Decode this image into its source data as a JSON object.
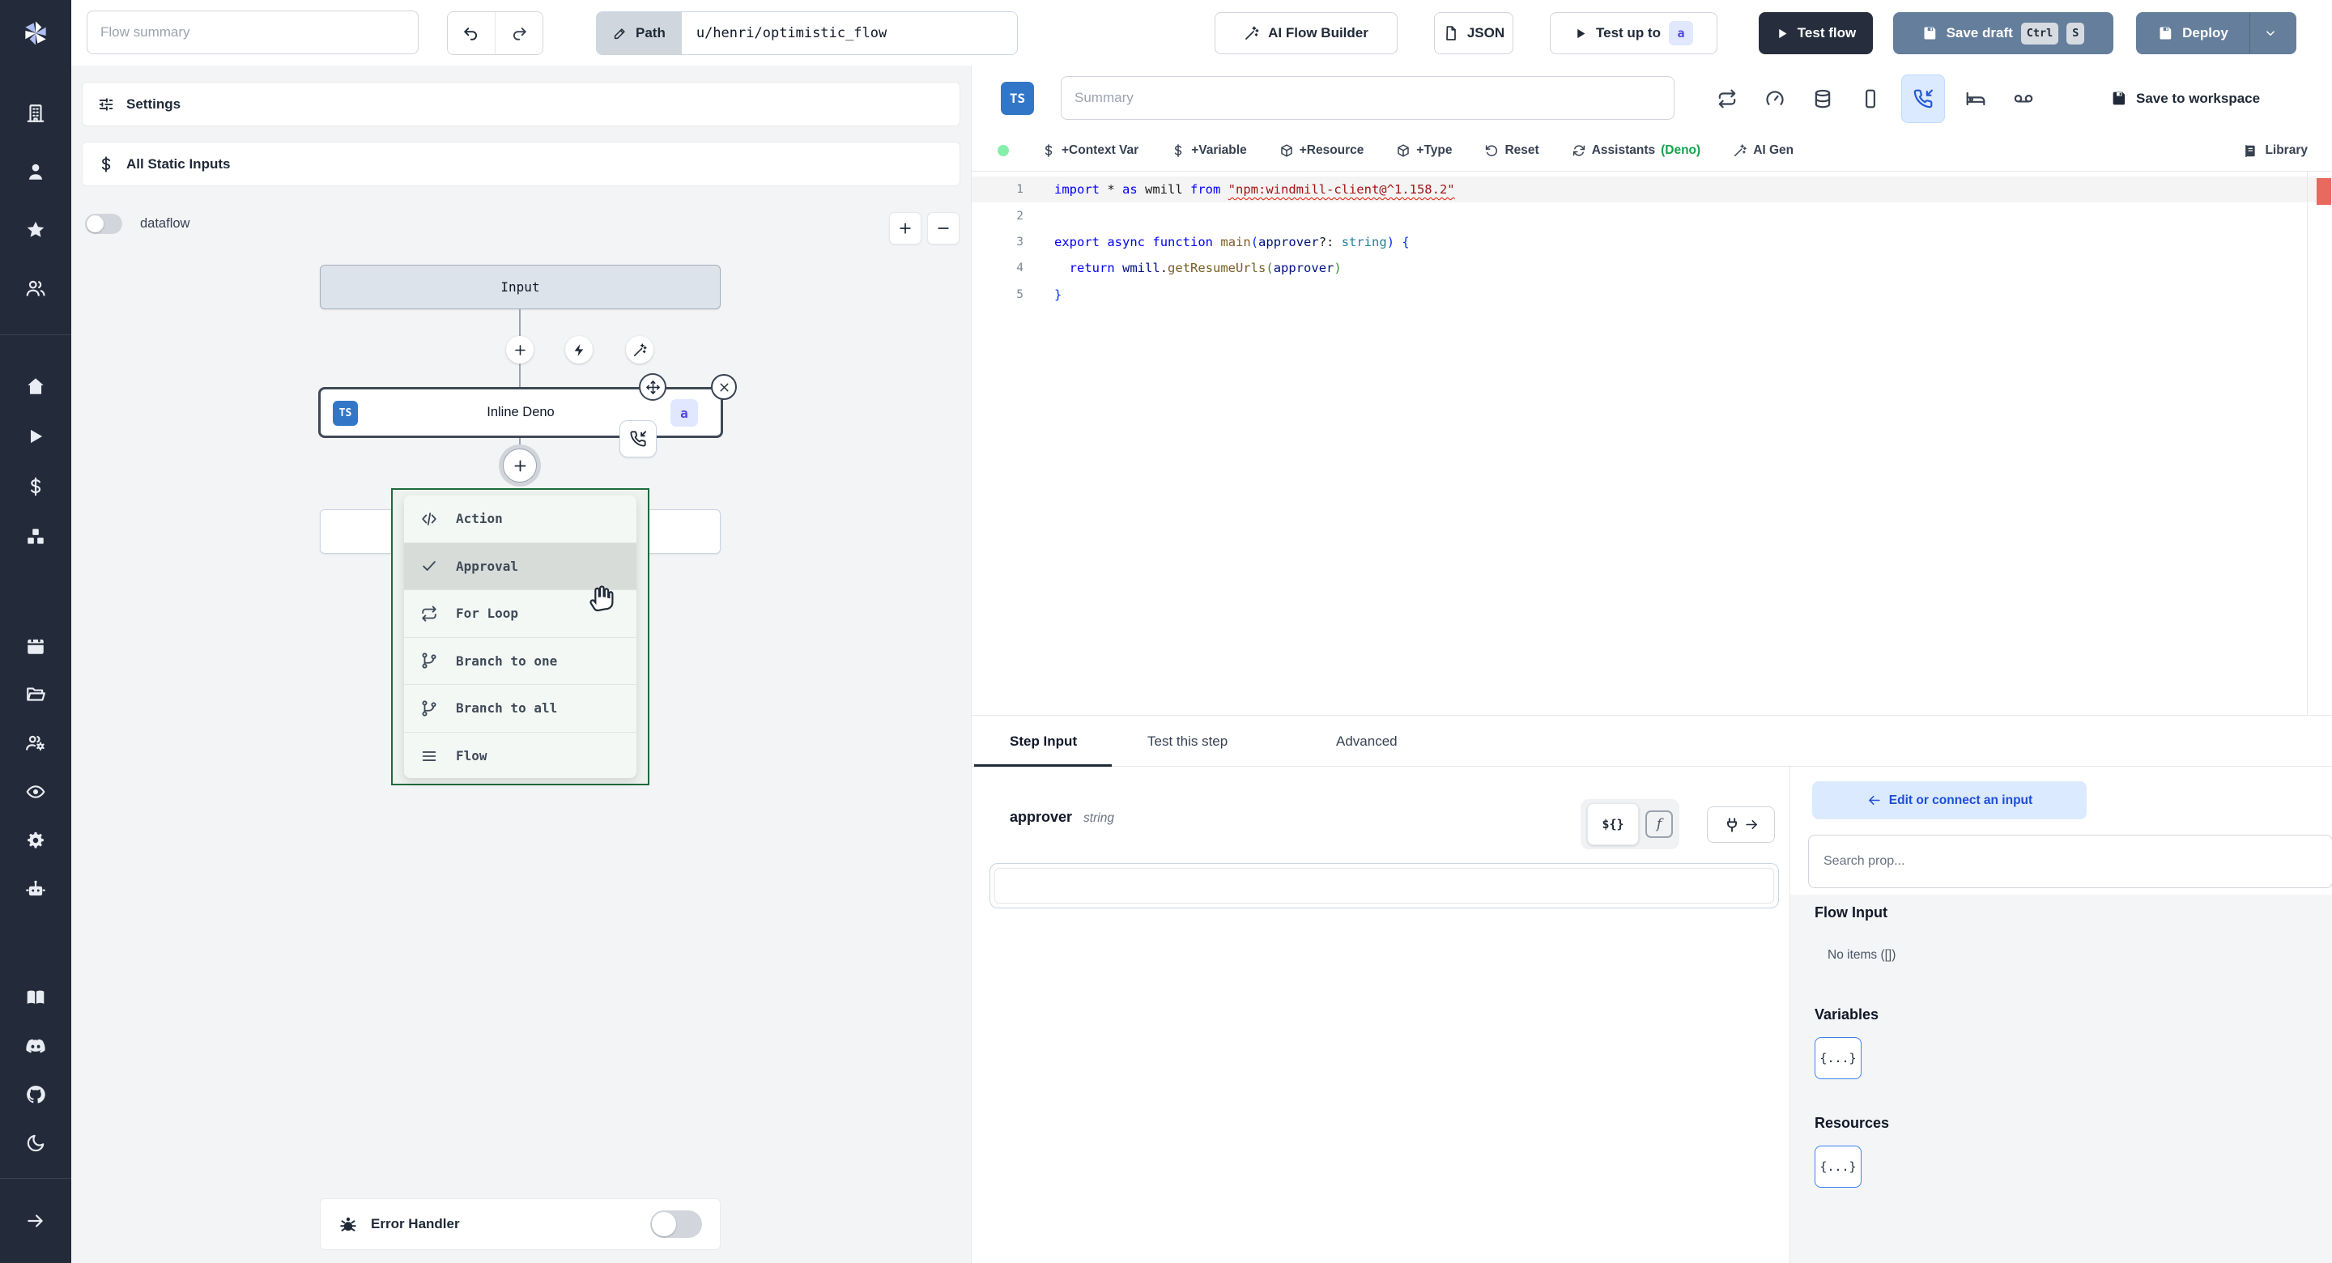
{
  "topbar": {
    "flow_summary_placeholder": "Flow summary",
    "path_label": "Path",
    "path_value": "u/henri/optimistic_flow",
    "ai_flow_builder": "AI Flow Builder",
    "json": "JSON",
    "test_up_to": "Test up to",
    "test_up_to_badge": "a",
    "test_flow": "Test flow",
    "save_draft": "Save draft",
    "save_draft_kbd": [
      "Ctrl",
      "S"
    ],
    "deploy": "Deploy"
  },
  "sidebar": {
    "groups": [
      [
        "building",
        "user",
        "star",
        "users"
      ],
      [
        "home",
        "play",
        "dollar",
        "boxes"
      ],
      [
        "calendar",
        "folder-open",
        "users-cog",
        "eye",
        "settings",
        "bot"
      ],
      [
        "book-open",
        "discord",
        "github",
        "moon"
      ]
    ],
    "footer": [
      "arrow-right"
    ]
  },
  "flow_panel": {
    "settings_label": "Settings",
    "all_static_inputs_label": "All Static Inputs",
    "dataflow_label": "dataflow",
    "input_node_label": "Input",
    "step_node": {
      "badge": "TS",
      "label": "Inline Deno",
      "suffix_badge": "a"
    },
    "error_handler_label": "Error Handler"
  },
  "add_menu": {
    "items": [
      {
        "icon": "code",
        "label": "Action"
      },
      {
        "icon": "check",
        "label": "Approval",
        "active": true
      },
      {
        "icon": "repeat",
        "label": "For Loop"
      },
      {
        "icon": "git-branch",
        "label": "Branch to one"
      },
      {
        "icon": "git-branch",
        "label": "Branch to all"
      },
      {
        "icon": "menu-lines",
        "label": "Flow"
      }
    ]
  },
  "editor": {
    "lang_badge": "TS",
    "summary_placeholder": "Summary",
    "toolbar_icons": [
      {
        "icon": "repeat"
      },
      {
        "icon": "gauge"
      },
      {
        "icon": "database"
      },
      {
        "icon": "smartphone"
      },
      {
        "icon": "phone-incoming",
        "active": true
      },
      {
        "icon": "bed"
      },
      {
        "icon": "voicemail"
      }
    ],
    "save_to_workspace": "Save to workspace",
    "actions": [
      {
        "icon": "dollar",
        "label": "+Context Var"
      },
      {
        "icon": "dollar",
        "label": "+Variable"
      },
      {
        "icon": "package",
        "label": "+Resource"
      },
      {
        "icon": "package",
        "label": "+Type"
      },
      {
        "icon": "rotate-ccw",
        "label": "Reset"
      },
      {
        "icon": "refresh-cw",
        "label": "Assistants",
        "suffix": "(Deno)"
      },
      {
        "icon": "wand",
        "label": "AI Gen"
      }
    ],
    "library": "Library",
    "code": {
      "lines": [
        {
          "num": "1",
          "hl": true,
          "tokens": [
            [
              "import",
              "kw"
            ],
            [
              " * ",
              "pl"
            ],
            [
              "as",
              "kw"
            ],
            [
              " wmill ",
              "pl"
            ],
            [
              "from",
              "kw"
            ],
            [
              " ",
              "pl"
            ],
            [
              "\"npm:windmill-client@^1.158.2\"",
              "str err"
            ]
          ]
        },
        {
          "num": "2",
          "tokens": []
        },
        {
          "num": "3",
          "tokens": [
            [
              "export",
              "kw"
            ],
            [
              " ",
              "pl"
            ],
            [
              "async",
              "kw"
            ],
            [
              " ",
              "pl"
            ],
            [
              "function",
              "kw"
            ],
            [
              " ",
              "pl"
            ],
            [
              "main",
              "fn"
            ],
            [
              "(",
              "br1"
            ],
            [
              "approver",
              "var"
            ],
            [
              "?: ",
              "pl"
            ],
            [
              "string",
              "type"
            ],
            [
              ")",
              "br1"
            ],
            [
              " {",
              "br1"
            ]
          ]
        },
        {
          "num": "4",
          "tokens": [
            [
              "  ",
              "pl"
            ],
            [
              "return",
              "kw"
            ],
            [
              " ",
              "pl"
            ],
            [
              "wmill",
              "var"
            ],
            [
              ".",
              "pl"
            ],
            [
              "getResumeUrls",
              "fn"
            ],
            [
              "(",
              "br2"
            ],
            [
              "approver",
              "var"
            ],
            [
              ")",
              "br2"
            ]
          ]
        },
        {
          "num": "5",
          "tokens": [
            [
              "}",
              "br1"
            ]
          ]
        }
      ]
    }
  },
  "tabs": {
    "items": [
      "Step Input",
      "Test this step",
      "Advanced"
    ],
    "active": 0
  },
  "step_input": {
    "field_name": "approver",
    "field_type": "string",
    "static_toggle_label": "${}",
    "func_toggle_label": "f",
    "value": ""
  },
  "connect_panel": {
    "back_label": "Edit or connect an input",
    "search_placeholder": "Search prop...",
    "flow_input_title": "Flow Input",
    "flow_input_empty": "No items ([])",
    "variables_title": "Variables",
    "variables_button": "{...}",
    "resources_title": "Resources",
    "resources_button": "{...}"
  },
  "colors": {
    "accent_blue": "#2563eb",
    "slate_button": "#647e9c",
    "dark_button": "#262e3d",
    "menu_green_border": "#1e6b3c",
    "deno_green": "#16a34a",
    "error_marker": "#e8695d",
    "ts_badge": "#3277c7"
  }
}
